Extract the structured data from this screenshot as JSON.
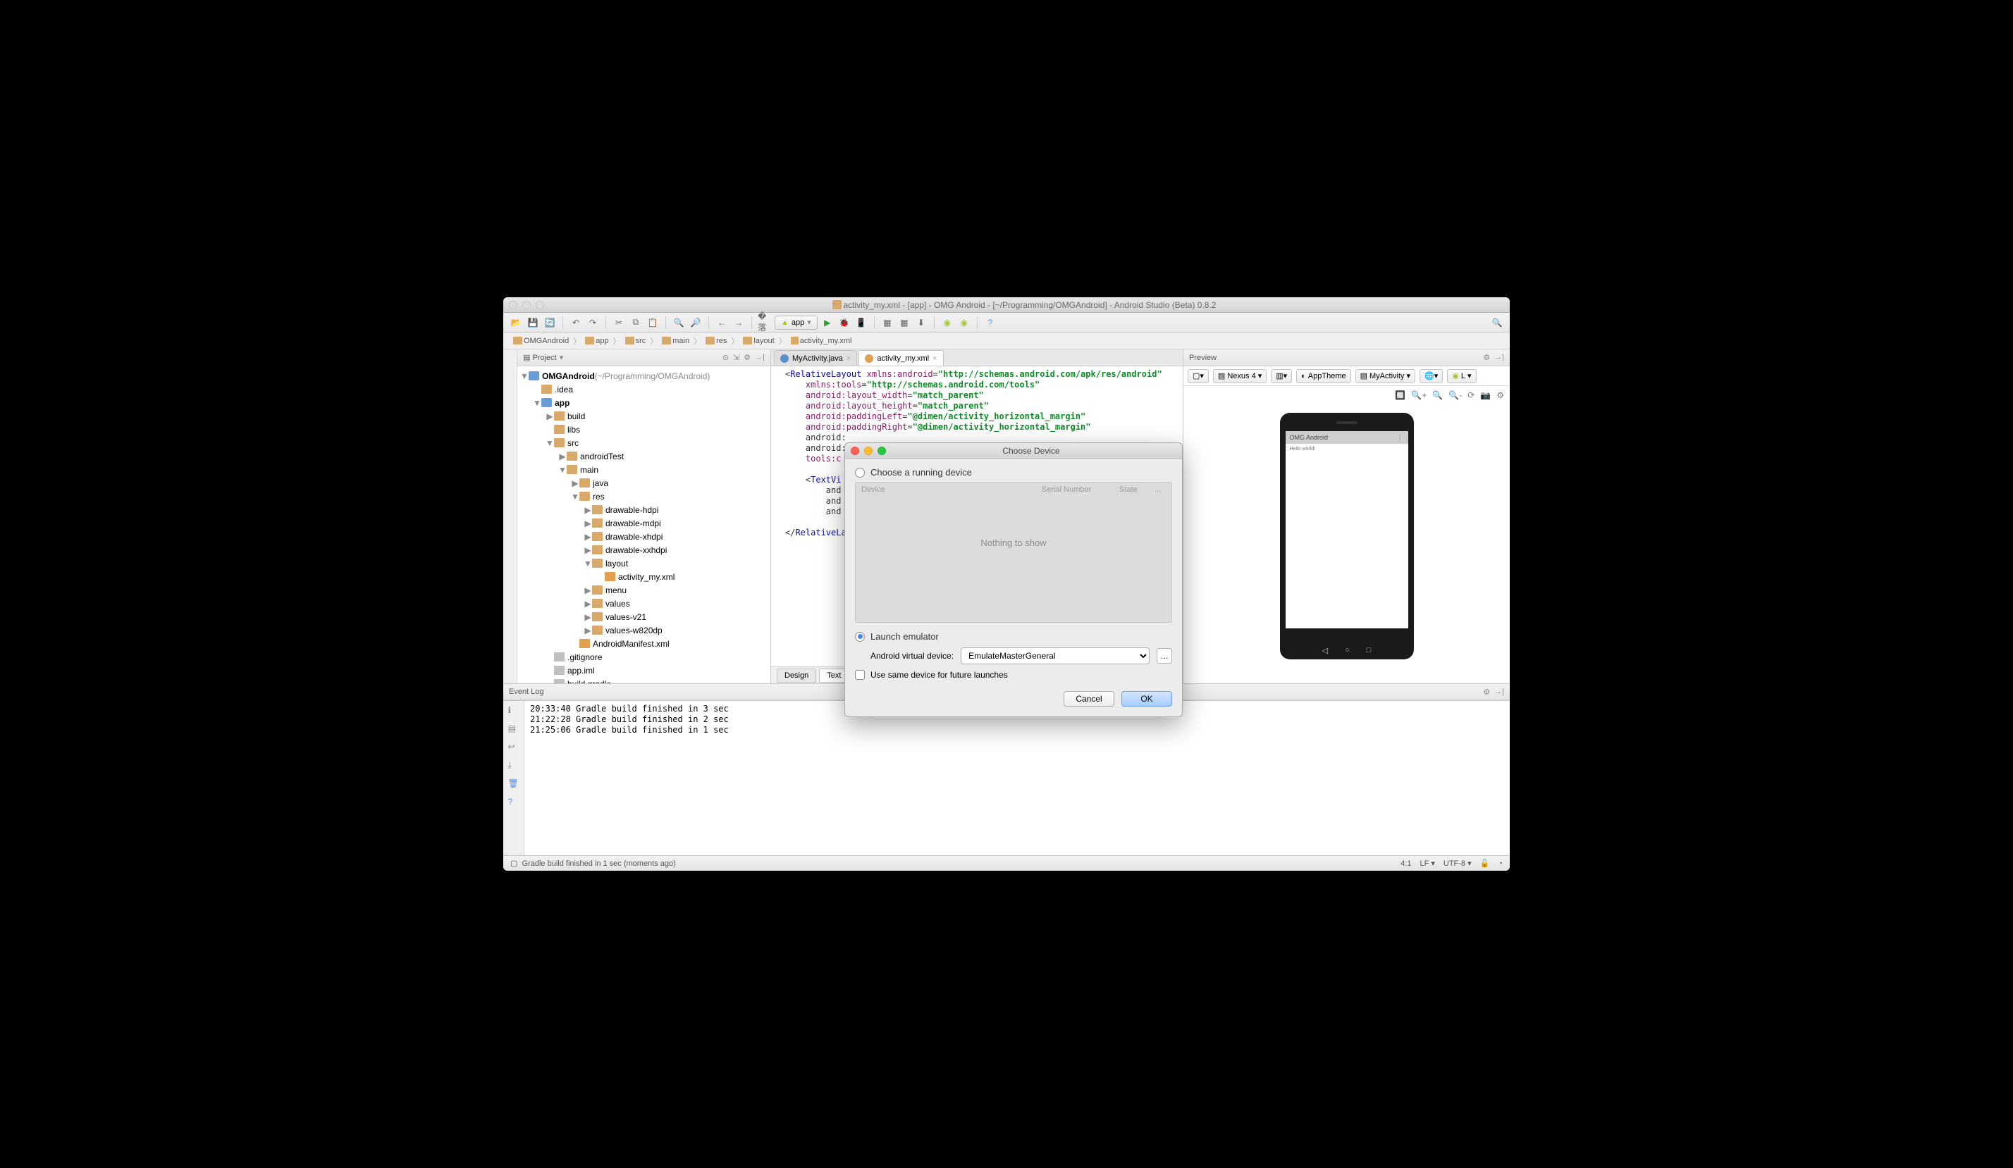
{
  "titlebar": {
    "text": "activity_my.xml - [app] - OMG Android - [~/Programming/OMGAndroid] - Android Studio (Beta) 0.8.2"
  },
  "toolbar": {
    "runconfig": "app"
  },
  "breadcrumb": [
    "OMGAndroid",
    "app",
    "src",
    "main",
    "res",
    "layout",
    "activity_my.xml"
  ],
  "project": {
    "header": "Project",
    "root": {
      "name": "OMGAndroid",
      "path": "(~/Programming/OMGAndroid)"
    },
    "nodes": [
      {
        "d": 1,
        "tw": "",
        "ico": "fold",
        "label": ".idea"
      },
      {
        "d": 1,
        "tw": "▼",
        "ico": "mod",
        "label": "app",
        "bold": true
      },
      {
        "d": 2,
        "tw": "▶",
        "ico": "fold",
        "label": "build"
      },
      {
        "d": 2,
        "tw": "",
        "ico": "fold",
        "label": "libs"
      },
      {
        "d": 2,
        "tw": "▼",
        "ico": "fold",
        "label": "src"
      },
      {
        "d": 3,
        "tw": "▶",
        "ico": "fold",
        "label": "androidTest"
      },
      {
        "d": 3,
        "tw": "▼",
        "ico": "fold",
        "label": "main"
      },
      {
        "d": 4,
        "tw": "▶",
        "ico": "fold",
        "label": "java"
      },
      {
        "d": 4,
        "tw": "▼",
        "ico": "fold",
        "label": "res"
      },
      {
        "d": 5,
        "tw": "▶",
        "ico": "fold",
        "label": "drawable-hdpi"
      },
      {
        "d": 5,
        "tw": "▶",
        "ico": "fold",
        "label": "drawable-mdpi"
      },
      {
        "d": 5,
        "tw": "▶",
        "ico": "fold",
        "label": "drawable-xhdpi"
      },
      {
        "d": 5,
        "tw": "▶",
        "ico": "fold",
        "label": "drawable-xxhdpi"
      },
      {
        "d": 5,
        "tw": "▼",
        "ico": "fold",
        "label": "layout"
      },
      {
        "d": 6,
        "tw": "",
        "ico": "fxml",
        "label": "activity_my.xml"
      },
      {
        "d": 5,
        "tw": "▶",
        "ico": "fold",
        "label": "menu"
      },
      {
        "d": 5,
        "tw": "▶",
        "ico": "fold",
        "label": "values"
      },
      {
        "d": 5,
        "tw": "▶",
        "ico": "fold",
        "label": "values-v21"
      },
      {
        "d": 5,
        "tw": "▶",
        "ico": "fold",
        "label": "values-w820dp"
      },
      {
        "d": 4,
        "tw": "",
        "ico": "fxml",
        "label": "AndroidManifest.xml"
      },
      {
        "d": 2,
        "tw": "",
        "ico": "ftxt",
        "label": ".gitignore"
      },
      {
        "d": 2,
        "tw": "",
        "ico": "ftxt",
        "label": "app.iml"
      },
      {
        "d": 2,
        "tw": "",
        "ico": "ftxt",
        "label": "build.gradle"
      }
    ]
  },
  "tabs": [
    {
      "label": "MyActivity.java",
      "icon": "j",
      "active": false
    },
    {
      "label": "activity_my.xml",
      "icon": "x",
      "active": true
    }
  ],
  "code_lines": [
    "<RelativeLayout xmlns:android=\"http://schemas.android.com/apk/res/android\"",
    "    xmlns:tools=\"http://schemas.android.com/tools\"",
    "    android:layout_width=\"match_parent\"",
    "    android:layout_height=\"match_parent\"",
    "    android:paddingLeft=\"@dimen/activity_horizontal_margin\"",
    "    android:paddingRight=\"@dimen/activity_horizontal_margin\"",
    "    android:",
    "    android:",
    "    tools:c",
    "",
    "    <TextVi",
    "        and",
    "        and",
    "        and",
    "",
    "</RelativeLa"
  ],
  "editor_bottom_tabs": [
    "Design",
    "Text"
  ],
  "preview": {
    "header": "Preview",
    "device": "Nexus 4",
    "theme": "AppTheme",
    "activity": "MyActivity",
    "api": "L",
    "app_title": "OMG Android",
    "hello": "Hello world!"
  },
  "eventlog": {
    "header": "Event Log",
    "lines": [
      "20:33:40 Gradle build finished in 3 sec",
      "21:22:28 Gradle build finished in 2 sec",
      "21:25:06 Gradle build finished in 1 sec"
    ]
  },
  "status": {
    "msg": "Gradle build finished in 1 sec (moments ago)",
    "pos": "4:1",
    "le": "LF",
    "enc": "UTF-8"
  },
  "dialog": {
    "title": "Choose Device",
    "radio_running": "Choose a running device",
    "cols": {
      "device": "Device",
      "serial": "Serial Number",
      "state": "State",
      "more": "..."
    },
    "empty": "Nothing to show",
    "radio_launch": "Launch emulator",
    "avd_label": "Android virtual device:",
    "avd_value": "EmulateMasterGeneral",
    "use_same": "Use same device for future launches",
    "cancel": "Cancel",
    "ok": "OK"
  }
}
